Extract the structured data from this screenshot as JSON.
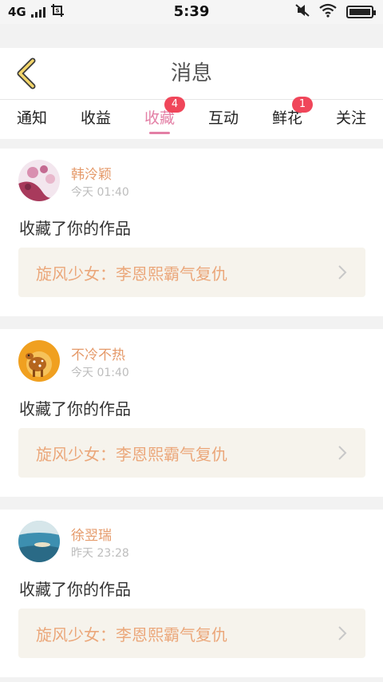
{
  "status_bar": {
    "network": "4G",
    "time": "5:39"
  },
  "header": {
    "title": "消息"
  },
  "tabs": [
    {
      "label": "通知",
      "active": false,
      "badge": null
    },
    {
      "label": "收益",
      "active": false,
      "badge": null
    },
    {
      "label": "收藏",
      "active": true,
      "badge": "4"
    },
    {
      "label": "互动",
      "active": false,
      "badge": null
    },
    {
      "label": "鲜花",
      "active": false,
      "badge": "1"
    },
    {
      "label": "关注",
      "active": false,
      "badge": null
    }
  ],
  "notifications": [
    {
      "user": "韩泠颖",
      "time": "今天 01:40",
      "action": "收藏了你的作品",
      "work": "旋风少女：李恩熙霸气复仇",
      "avatar": "flowers-avatar"
    },
    {
      "user": "不冷不热",
      "time": "今天 01:40",
      "action": "收藏了你的作品",
      "work": "旋风少女：李恩熙霸气复仇",
      "avatar": "deer-avatar"
    },
    {
      "user": "徐翌瑞",
      "time": "昨天 23:28",
      "action": "收藏了你的作品",
      "work": "旋风少女：李恩熙霸气复仇",
      "avatar": "sea-avatar"
    }
  ],
  "colors": {
    "accent": "#e37fa5",
    "badge": "#f0465a",
    "username": "#e59a6a",
    "work_title": "#eba77a",
    "back_arrow": "#f2d56a"
  }
}
